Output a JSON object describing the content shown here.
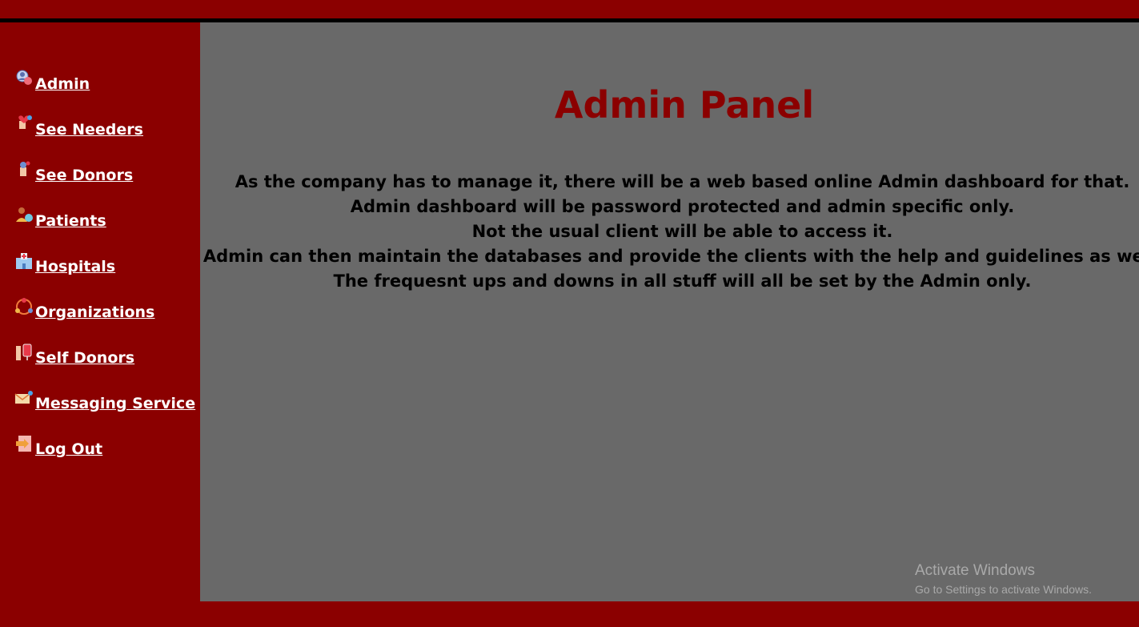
{
  "sidebar": {
    "items": [
      {
        "label": "Admin",
        "icon": "admin-user-icon"
      },
      {
        "label": "See Needers",
        "icon": "needers-hand-icon"
      },
      {
        "label": "See Donors",
        "icon": "donors-hand-icon"
      },
      {
        "label": "Patients",
        "icon": "patients-icon"
      },
      {
        "label": "Hospitals",
        "icon": "hospital-icon"
      },
      {
        "label": "Organizations",
        "icon": "organizations-icon"
      },
      {
        "label": "Self Donors",
        "icon": "blood-bag-icon"
      },
      {
        "label": "Messaging Service",
        "icon": "envelope-icon"
      },
      {
        "label": "Log Out",
        "icon": "logout-icon"
      }
    ]
  },
  "main": {
    "title": "Admin Panel",
    "lines": [
      "As the company has to manage it, there will be a web based online Admin dashboard for that.",
      "Admin dashboard will be password protected and admin specific only.",
      "Not the usual client will be able to access it.",
      "Admin can then maintain the databases and provide the clients with the help and guidelines as well.",
      "The frequesnt ups and downs in all stuff will all be set by the Admin only."
    ]
  },
  "watermark": {
    "title": "Activate Windows",
    "subtitle": "Go to Settings to activate Windows."
  },
  "colors": {
    "brand_red": "#8b0000",
    "content_gray": "#696969",
    "top_line": "#000000",
    "text_white": "#ffffff"
  }
}
